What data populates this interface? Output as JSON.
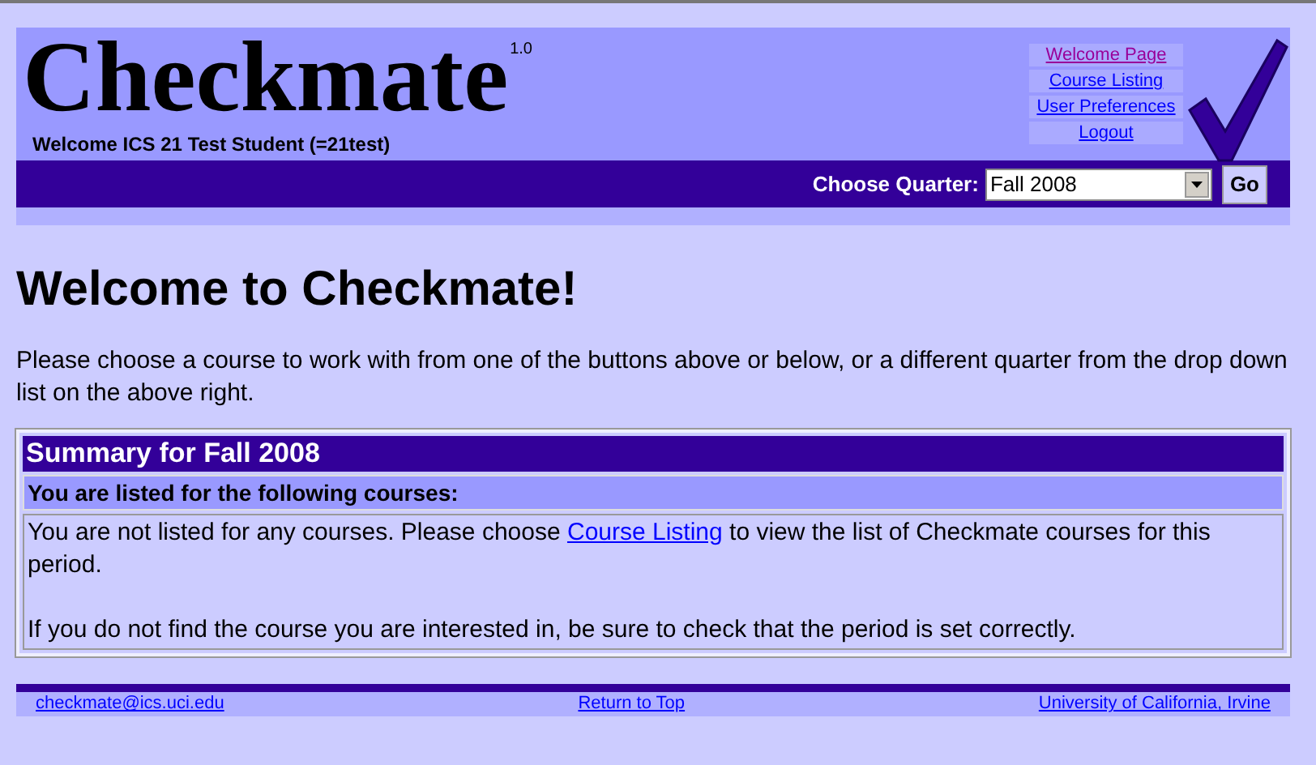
{
  "header": {
    "title": "Checkmate",
    "version": "1.0",
    "welcome": "Welcome ICS 21 Test Student (=21test)",
    "nav_links": [
      {
        "label": "Welcome Page",
        "visited": true
      },
      {
        "label": "Course Listing",
        "visited": false
      },
      {
        "label": "User Preferences",
        "visited": false
      },
      {
        "label": "Logout",
        "visited": false
      }
    ],
    "quarter": {
      "label": "Choose Quarter:",
      "value": "Fall 2008",
      "button": "Go"
    }
  },
  "heading": "Welcome to Checkmate!",
  "intro": "Please choose a course to work with from one of the buttons above or below, or a different quarter from the drop down list on the above right.",
  "summary": {
    "title": "Summary for Fall 2008",
    "subtitle": "You are listed for the following courses:",
    "message_before": "You are not listed for any courses. Please choose ",
    "message_link": "Course Listing",
    "message_after": " to view the list of Checkmate courses for this period.",
    "note": "If you do not find the course you are interested in, be sure to check that the period is set correctly."
  },
  "footer": [
    "checkmate@ics.uci.edu",
    "Return to Top",
    "University of California, Irvine"
  ]
}
